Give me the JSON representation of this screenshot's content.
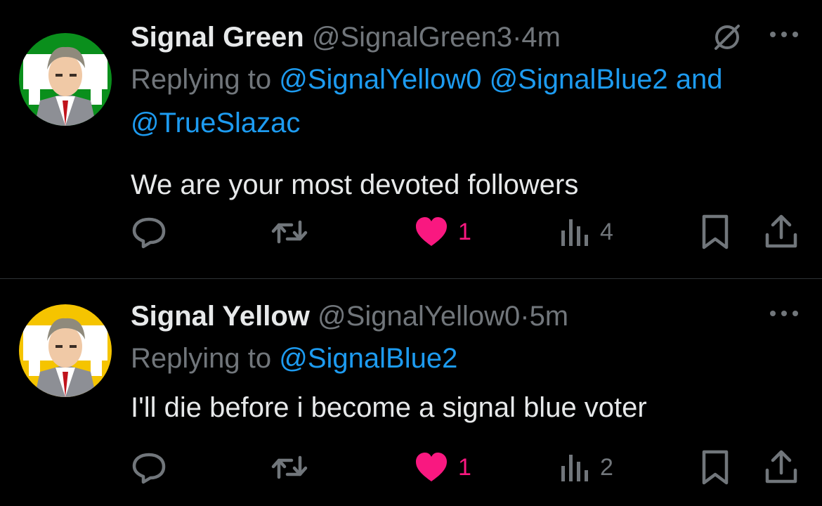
{
  "tweets": [
    {
      "name": "Signal Green",
      "handle": "@SignalGreen3",
      "separator": "·",
      "time": "4m",
      "replying_prefix": "Replying to",
      "mentions": [
        "@SignalYellow0",
        "@SignalBlue2",
        "and",
        "@TrueSlazac"
      ],
      "text": "We are your most devoted followers",
      "likes": "1",
      "views": "4",
      "avatar_bg": "#0a8f1c"
    },
    {
      "name": "Signal Yellow",
      "handle": "@SignalYellow0",
      "separator": "·",
      "time": "5m",
      "replying_prefix": "Replying to",
      "mentions": [
        "@SignalBlue2"
      ],
      "text": "I'll die before i become a signal blue voter",
      "likes": "1",
      "views": "2",
      "avatar_bg": "#f5c400"
    }
  ],
  "colors": {
    "background": "#000000",
    "text": "#e7e9ea",
    "muted": "#71767b",
    "link": "#1d9bf0",
    "like": "#f91880"
  },
  "icons": [
    "reply-icon",
    "retweet-icon",
    "heart-icon",
    "views-icon",
    "bookmark-icon",
    "share-icon",
    "more-icon",
    "no-sign-icon"
  ]
}
